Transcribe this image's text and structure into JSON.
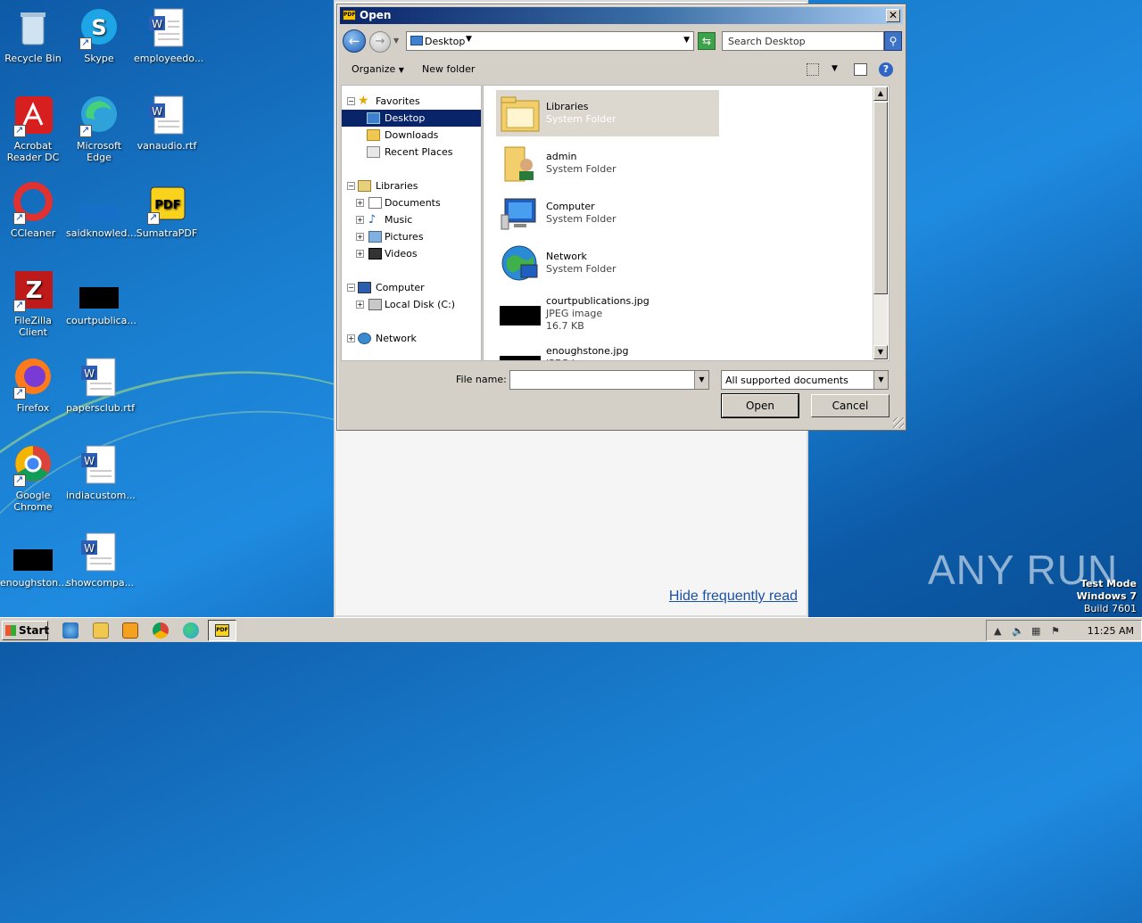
{
  "desktop": {
    "icons": [
      {
        "label": "Recycle Bin"
      },
      {
        "label": "Skype"
      },
      {
        "label": "employeedo..."
      },
      {
        "label": "Acrobat Reader DC"
      },
      {
        "label": "Microsoft Edge"
      },
      {
        "label": "vanaudio.rtf"
      },
      {
        "label": "CCleaner"
      },
      {
        "label": "saidknowled..."
      },
      {
        "label": "SumatraPDF"
      },
      {
        "label": "FileZilla Client"
      },
      {
        "label": "courtpublica..."
      },
      {
        "label": "Firefox"
      },
      {
        "label": "papersclub.rtf"
      },
      {
        "label": "Google Chrome"
      },
      {
        "label": "indiacustom..."
      },
      {
        "label": "enoughston..."
      },
      {
        "label": "showcompa..."
      }
    ]
  },
  "background_window": {
    "link": "Hide frequently read"
  },
  "dialog": {
    "title": "Open",
    "app_badge": "PDF",
    "address": "Desktop",
    "search_placeholder": "Search Desktop",
    "toolbar": {
      "organize": "Organize",
      "new_folder": "New folder"
    },
    "nav": {
      "favorites": "Favorites",
      "desktop": "Desktop",
      "downloads": "Downloads",
      "recent": "Recent Places",
      "libraries": "Libraries",
      "documents": "Documents",
      "music": "Music",
      "pictures": "Pictures",
      "videos": "Videos",
      "computer": "Computer",
      "local_disk": "Local Disk (C:)",
      "network": "Network"
    },
    "files": [
      {
        "name": "Libraries",
        "type": "System Folder",
        "size": ""
      },
      {
        "name": "admin",
        "type": "System Folder",
        "size": ""
      },
      {
        "name": "Computer",
        "type": "System Folder",
        "size": ""
      },
      {
        "name": "Network",
        "type": "System Folder",
        "size": ""
      },
      {
        "name": "courtpublications.jpg",
        "type": "JPEG image",
        "size": "16.7 KB"
      },
      {
        "name": "enoughstone.jpg",
        "type": "JPEG image",
        "size": ""
      }
    ],
    "file_name_label": "File name:",
    "file_name_value": "",
    "file_type": "All supported documents",
    "open_button": "Open",
    "cancel_button": "Cancel"
  },
  "taskbar": {
    "start": "Start",
    "clock": "11:25 AM"
  },
  "watermark": "ANY RUN",
  "test_mode": {
    "line1": "Test Mode",
    "line2": "Windows 7",
    "line3": "Build 7601"
  },
  "colors": {
    "accent": "#0a246a",
    "desktop": "#1a7fd0",
    "chrome": "#d4d0c8"
  }
}
